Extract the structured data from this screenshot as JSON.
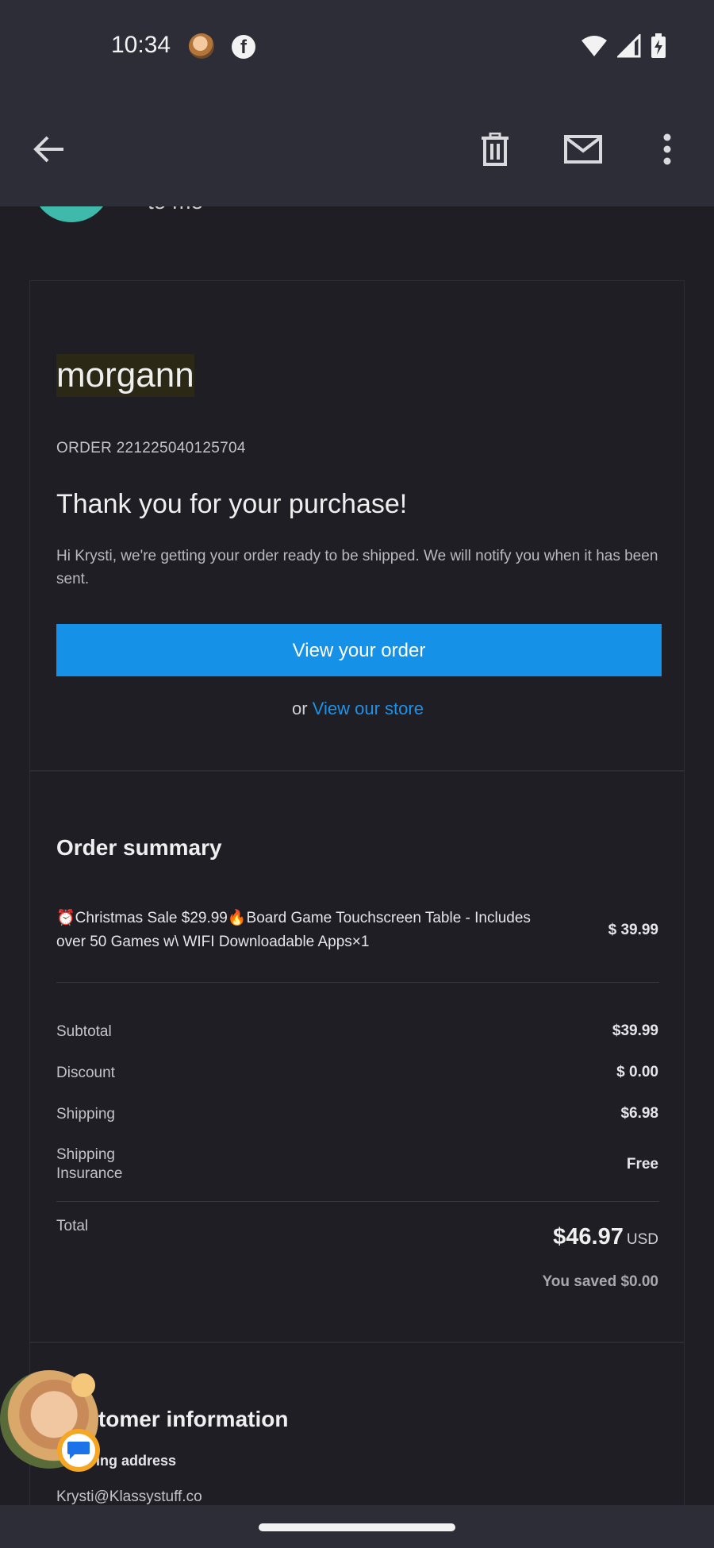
{
  "status_bar": {
    "time": "10:34",
    "fb_glyph": "f"
  },
  "toolbar": {
    "back": "back-arrow-icon",
    "delete": "trash-icon",
    "mark_unread": "mail-icon",
    "more": "more-vert-icon"
  },
  "email": {
    "to_label": "to me",
    "store_name": "morgann",
    "order_number": "ORDER 221225040125704",
    "heading": "Thank you for your purchase!",
    "intro": "Hi Krysti, we're getting your order ready to be shipped. We will notify you when it has been sent.",
    "view_order_button": "View your order",
    "or_text": "or",
    "view_store_link": "View our store"
  },
  "summary": {
    "title": "Order summary",
    "item": {
      "description": "⏰Christmas Sale $29.99🔥Board Game Touchscreen Table - Includes over 50 Games w\\ WIFI Downloadable Apps×1",
      "price": "$ 39.99"
    },
    "rows": [
      {
        "label": "Subtotal",
        "value": "$39.99"
      },
      {
        "label": "Discount",
        "value": "$ 0.00"
      },
      {
        "label": "Shipping",
        "value": "$6.98"
      },
      {
        "label": "Shipping Insurance",
        "value": "Free"
      }
    ],
    "total_label": "Total",
    "total_amount": "$46.97",
    "total_currency": "USD",
    "saved": "You saved $0.00"
  },
  "customer": {
    "title": "Customer information",
    "title_visible": "tomer information",
    "shipping_label": "Shipping address",
    "shipping_visible": "ing address",
    "email": "Krysti@Klassystuff.co"
  },
  "colors": {
    "accent": "#1591e8",
    "link": "#1e92e8",
    "background": "#1e1e24",
    "bar": "#2c2d36"
  }
}
